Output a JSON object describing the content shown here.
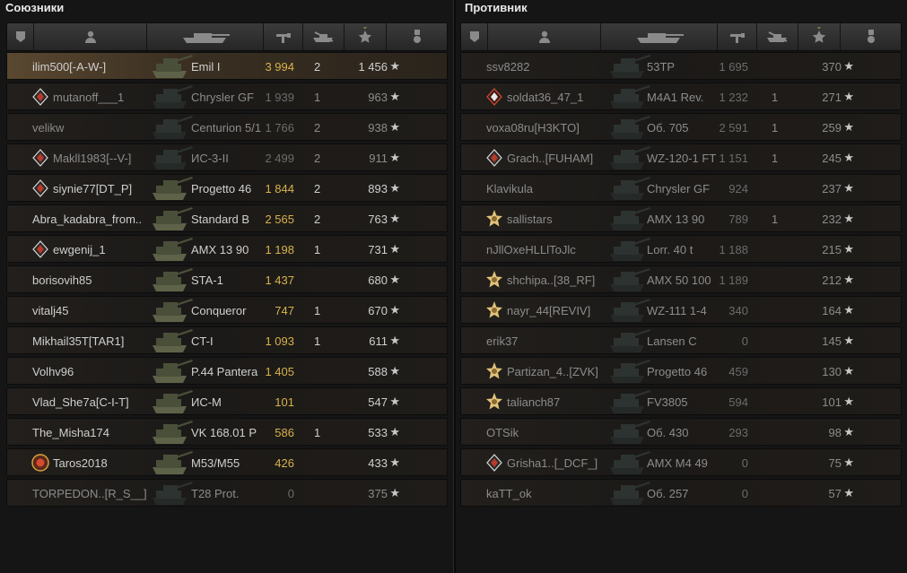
{
  "left": {
    "title": "Союзники",
    "rows": [
      {
        "name": "ilim500[-A-W-]",
        "tank": "Emil I",
        "damage": "3 994",
        "kills": "2",
        "xp": "1 456",
        "me": true,
        "dead": false,
        "rank": "none"
      },
      {
        "name": "mutanoff___1",
        "tank": "Chrysler GF",
        "damage": "1 939",
        "kills": "1",
        "xp": "963",
        "me": false,
        "dead": true,
        "rank": "diamond-badge-icon"
      },
      {
        "name": "velikw",
        "tank": "Centurion 5/1",
        "damage": "1 766",
        "kills": "2",
        "xp": "938",
        "me": false,
        "dead": true,
        "rank": "none"
      },
      {
        "name": "Makll1983[--V-]",
        "tank": "ИС-3-II",
        "damage": "2 499",
        "kills": "2",
        "xp": "911",
        "me": false,
        "dead": true,
        "rank": "diamond-badge-icon"
      },
      {
        "name": "siynie77[DT_P]",
        "tank": "Progetto 46",
        "damage": "1 844",
        "kills": "2",
        "xp": "893",
        "me": false,
        "dead": false,
        "rank": "diamond-badge-icon"
      },
      {
        "name": "Abra_kadabra_from..",
        "tank": "Standard B",
        "damage": "2 565",
        "kills": "2",
        "xp": "763",
        "me": false,
        "dead": false,
        "rank": "none"
      },
      {
        "name": "ewgenij_1",
        "tank": "AMX 13 90",
        "damage": "1 198",
        "kills": "1",
        "xp": "731",
        "me": false,
        "dead": false,
        "rank": "diamond-badge-icon"
      },
      {
        "name": "borisovih85",
        "tank": "STA-1",
        "damage": "1 437",
        "kills": "",
        "xp": "680",
        "me": false,
        "dead": false,
        "rank": "none"
      },
      {
        "name": "vitalj45",
        "tank": "Conqueror",
        "damage": "747",
        "kills": "1",
        "xp": "670",
        "me": false,
        "dead": false,
        "rank": "none"
      },
      {
        "name": "Mikhail35T[TAR1]",
        "tank": "CT-I",
        "damage": "1 093",
        "kills": "1",
        "xp": "611",
        "me": false,
        "dead": false,
        "rank": "none"
      },
      {
        "name": "Volhv96",
        "tank": "P.44 Pantera",
        "damage": "1 405",
        "kills": "",
        "xp": "588",
        "me": false,
        "dead": false,
        "rank": "none"
      },
      {
        "name": "Vlad_She7a[C-I-T]",
        "tank": "ИС-М",
        "damage": "101",
        "kills": "",
        "xp": "547",
        "me": false,
        "dead": false,
        "rank": "none"
      },
      {
        "name": "The_Misha174",
        "tank": "VK 168.01 P",
        "damage": "586",
        "kills": "1",
        "xp": "533",
        "me": false,
        "dead": false,
        "rank": "none"
      },
      {
        "name": "Taros2018",
        "tank": "M53/M55",
        "damage": "426",
        "kills": "",
        "xp": "433",
        "me": false,
        "dead": false,
        "rank": "round-badge-icon"
      },
      {
        "name": "TORPEDON..[R_S__]",
        "tank": "T28 Prot.",
        "damage": "0",
        "kills": "",
        "xp": "375",
        "me": false,
        "dead": true,
        "rank": "none"
      }
    ]
  },
  "right": {
    "title": "Противник",
    "rows": [
      {
        "name": "ssv8282",
        "tank": "53TP",
        "damage": "1 695",
        "kills": "",
        "xp": "370",
        "dead": true,
        "rank": "none"
      },
      {
        "name": "soldat36_47_1",
        "tank": "M4A1 Rev.",
        "damage": "1 232",
        "kills": "1",
        "xp": "271",
        "dead": true,
        "rank": "red-diamond-badge-icon"
      },
      {
        "name": "voxa08ru[H3KTO]",
        "tank": "Об. 705",
        "damage": "2 591",
        "kills": "1",
        "xp": "259",
        "dead": true,
        "rank": "none"
      },
      {
        "name": "Grach..[FUHAM]",
        "tank": "WZ-120-1 FT",
        "damage": "1 151",
        "kills": "1",
        "xp": "245",
        "dead": true,
        "rank": "diamond-badge-icon"
      },
      {
        "name": "Klavikula",
        "tank": "Chrysler GF",
        "damage": "924",
        "kills": "",
        "xp": "237",
        "dead": true,
        "rank": "none"
      },
      {
        "name": "sallistars",
        "tank": "AMX 13 90",
        "damage": "789",
        "kills": "1",
        "xp": "232",
        "dead": true,
        "rank": "star-badge-icon"
      },
      {
        "name": "nJllOxeHLLlToJlc",
        "tank": "Lorr. 40 t",
        "damage": "1 188",
        "kills": "",
        "xp": "215",
        "dead": true,
        "rank": "none"
      },
      {
        "name": "shchipa..[38_RF]",
        "tank": "AMX 50 100",
        "damage": "1 189",
        "kills": "",
        "xp": "212",
        "dead": true,
        "rank": "star-badge-icon"
      },
      {
        "name": "nayr_44[REVIV]",
        "tank": "WZ-111 1-4",
        "damage": "340",
        "kills": "",
        "xp": "164",
        "dead": true,
        "rank": "star-badge-icon"
      },
      {
        "name": "erik37",
        "tank": "Lansen C",
        "damage": "0",
        "kills": "",
        "xp": "145",
        "dead": true,
        "rank": "none"
      },
      {
        "name": "Partizan_4..[ZVK]",
        "tank": "Progetto 46",
        "damage": "459",
        "kills": "",
        "xp": "130",
        "dead": true,
        "rank": "star-badge-icon"
      },
      {
        "name": "talianch87",
        "tank": "FV3805",
        "damage": "594",
        "kills": "",
        "xp": "101",
        "dead": true,
        "rank": "star-badge-icon"
      },
      {
        "name": "OTSik",
        "tank": "Об. 430",
        "damage": "293",
        "kills": "",
        "xp": "98",
        "dead": true,
        "rank": "none"
      },
      {
        "name": "Grisha1..[_DCF_]",
        "tank": "AMX M4 49",
        "damage": "0",
        "kills": "",
        "xp": "75",
        "dead": true,
        "rank": "diamond-badge-icon"
      },
      {
        "name": "kaTT_ok",
        "tank": "Об. 257",
        "damage": "0",
        "kills": "",
        "xp": "57",
        "dead": true,
        "rank": "none"
      }
    ]
  },
  "header_icons": [
    "vehicle-type-icon",
    "player-icon",
    "tank-icon",
    "damage-icon",
    "kills-icon",
    "experience-star-icon",
    "medal-icon"
  ],
  "colors": {
    "damage": "#d8b24a",
    "highlight": "#5a4830",
    "dead_text": "#8c8c8c"
  }
}
